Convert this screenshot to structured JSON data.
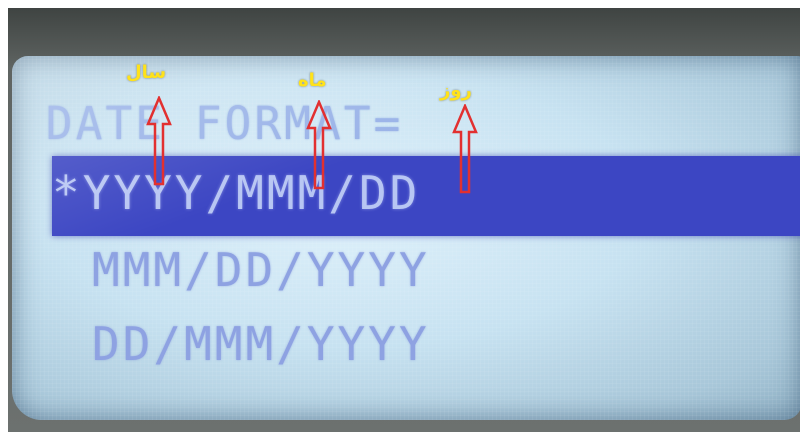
{
  "screen": {
    "title": "DATE FORMAT=",
    "selection_marker": "*",
    "options": [
      {
        "label": "YYYY/MMM/DD",
        "selected": true
      },
      {
        "label": "MMM/DD/YYYY",
        "selected": false
      },
      {
        "label": "DD/MMM/YYYY",
        "selected": false
      }
    ]
  },
  "annotations": {
    "year": "سال",
    "month": "ماه",
    "day": "روز"
  },
  "colors": {
    "lcd_background": "#c7e2f1",
    "highlight_bar": "#3c46c3",
    "text": "#8ea2e2",
    "annotation_text": "#ffe21a",
    "annotation_arrow": "#e23030"
  }
}
